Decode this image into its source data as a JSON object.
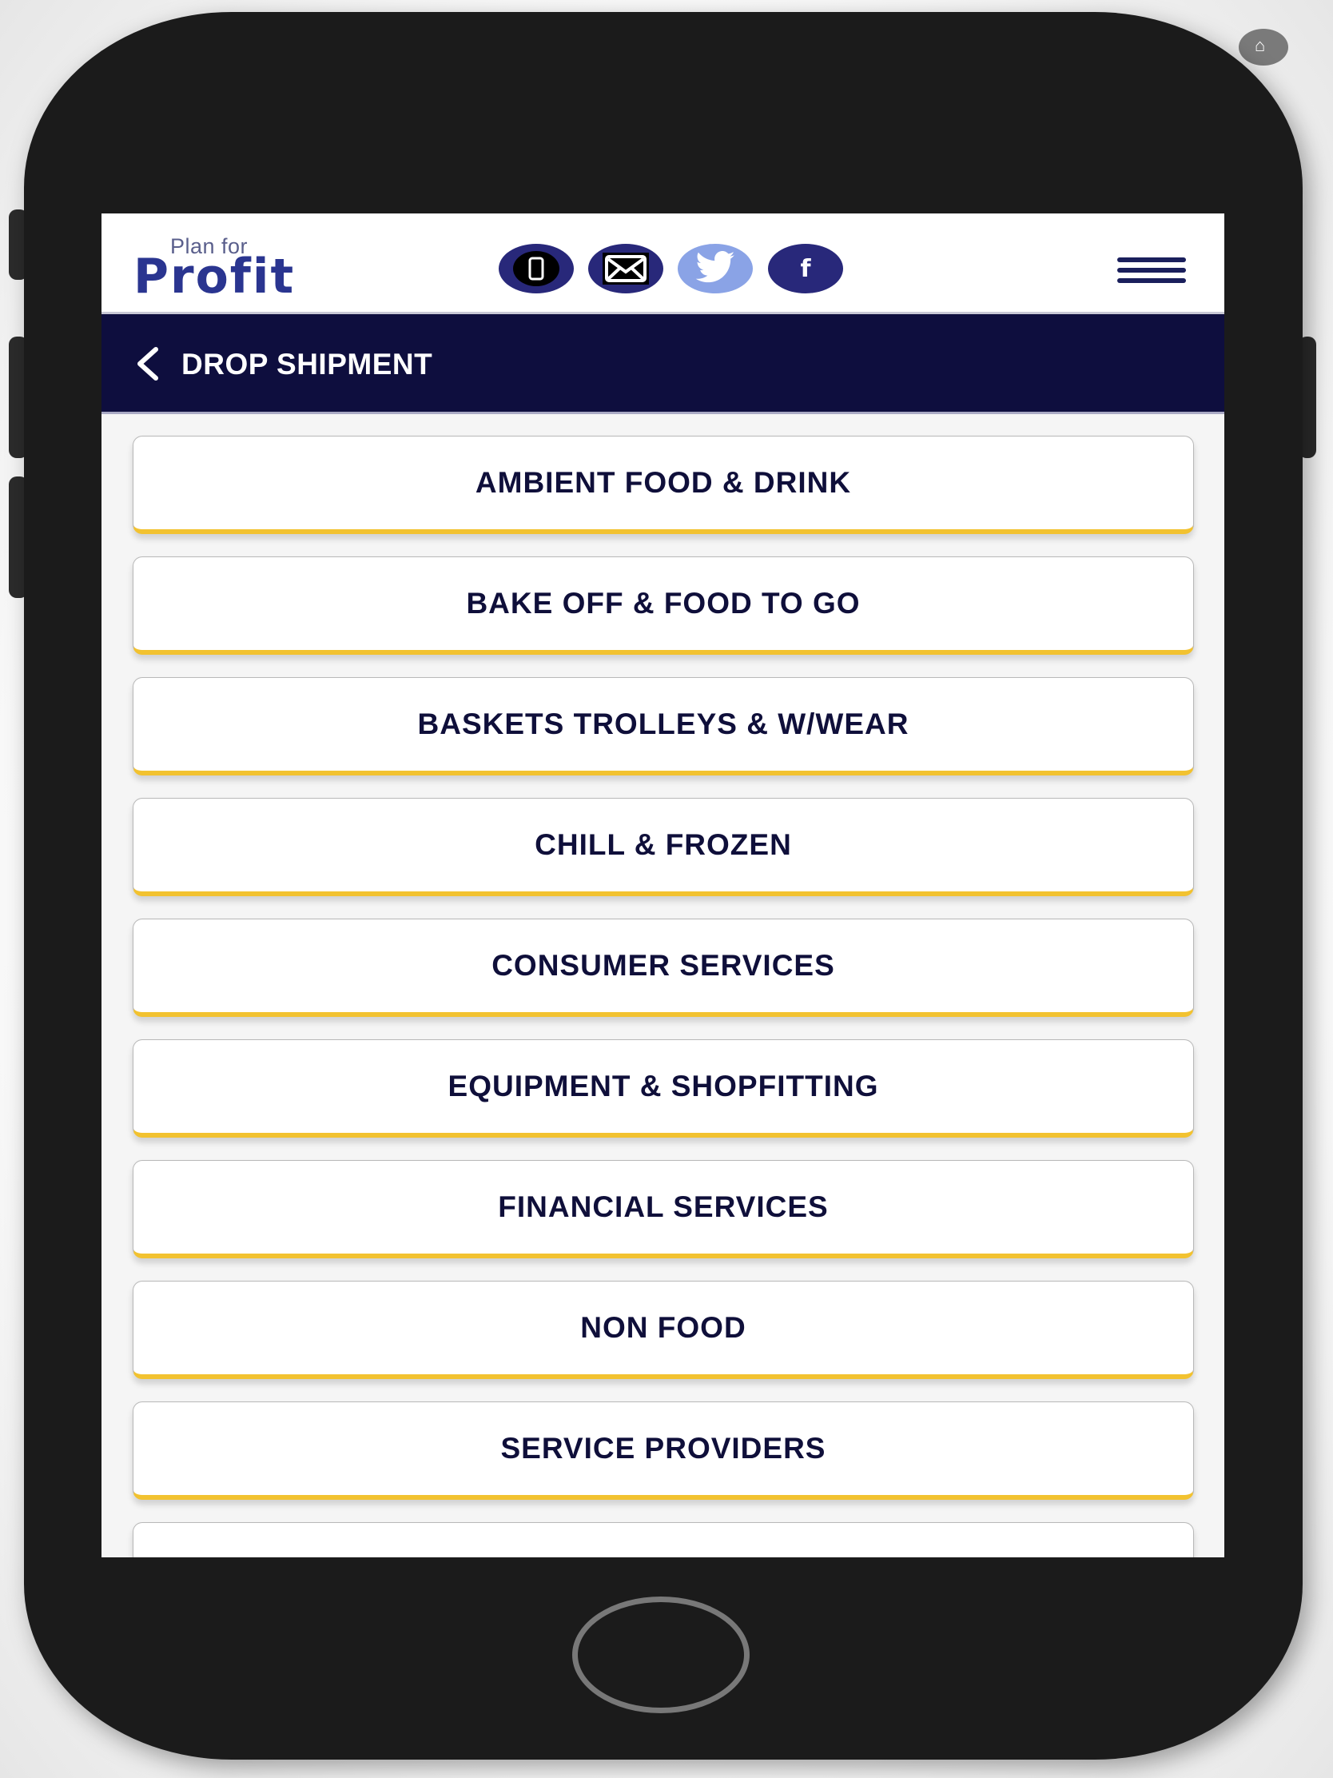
{
  "device": {
    "type": "phone mockup",
    "frame_color": "#1b1b1b",
    "home_button": "home-button"
  },
  "header": {
    "logo": {
      "top_text": "Plan for",
      "main_text": "Profit",
      "color": "#2a3590"
    },
    "social_icons": [
      {
        "name": "phone-icon",
        "color": "#28287a"
      },
      {
        "name": "mail-icon",
        "color": "#28287a"
      },
      {
        "name": "twitter-icon",
        "color": "#8aa3e6"
      },
      {
        "name": "facebook-icon",
        "color": "#28287a",
        "glyph": "f"
      }
    ],
    "menu_icon": "hamburger-menu-icon"
  },
  "nav": {
    "back_icon": "chevron-left-icon",
    "title": "DROP SHIPMENT",
    "background": "#0e0e3e"
  },
  "categories": [
    {
      "label": "AMBIENT FOOD & DRINK"
    },
    {
      "label": "BAKE OFF & FOOD TO GO"
    },
    {
      "label": "BASKETS TROLLEYS & W/WEAR"
    },
    {
      "label": "CHILL & FROZEN"
    },
    {
      "label": "CONSUMER SERVICES"
    },
    {
      "label": "EQUIPMENT & SHOPFITTING"
    },
    {
      "label": "FINANCIAL SERVICES"
    },
    {
      "label": "NON FOOD"
    },
    {
      "label": "SERVICE PROVIDERS"
    },
    {
      "label": ""
    }
  ],
  "colors": {
    "accent_underline": "#f2c230",
    "card_text": "#0f0f3a",
    "list_background": "#f5f5f5"
  }
}
